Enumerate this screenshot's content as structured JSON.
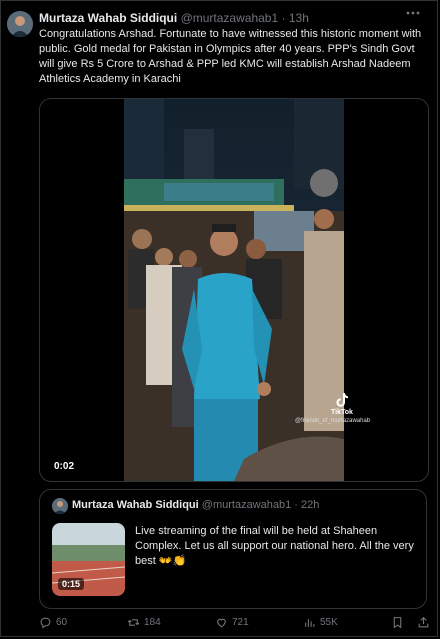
{
  "tweet": {
    "author_name": "Murtaza Wahab Siddiqui",
    "handle": "@murtazawahab1",
    "separator": "·",
    "time": "13h",
    "more_icon": "more-icon",
    "text": "Congratulations Arshad. Fortunate to have witnessed this historic moment with public. Gold medal for Pakistan in Olympics after 40 years. PPP's Sindh Govt will give Rs 5 Crore to Arshad & PPP led KMC will establish Arshad Nadeem Athletics Academy in Karachi",
    "video": {
      "duration": "0:02",
      "tiktok_label": "TikTok",
      "tiktok_handle": "@friends_of_murtazawahab"
    }
  },
  "quote": {
    "author_name": "Murtaza Wahab Siddiqui",
    "handle": "@murtazawahab1",
    "separator": "·",
    "time": "22h",
    "video_duration": "0:15",
    "text": "Live streaming of the final will be held at Shaheen Complex. Let us all support our national hero. All the very best 👐👏"
  },
  "actions": {
    "replies": "60",
    "retweets": "184",
    "likes": "721",
    "views": "55K"
  },
  "colors": {
    "background": "#000000",
    "text": "#e7e9ea",
    "muted": "#71767b",
    "border": "#2f3336",
    "kurta": "#2aa3c9"
  }
}
